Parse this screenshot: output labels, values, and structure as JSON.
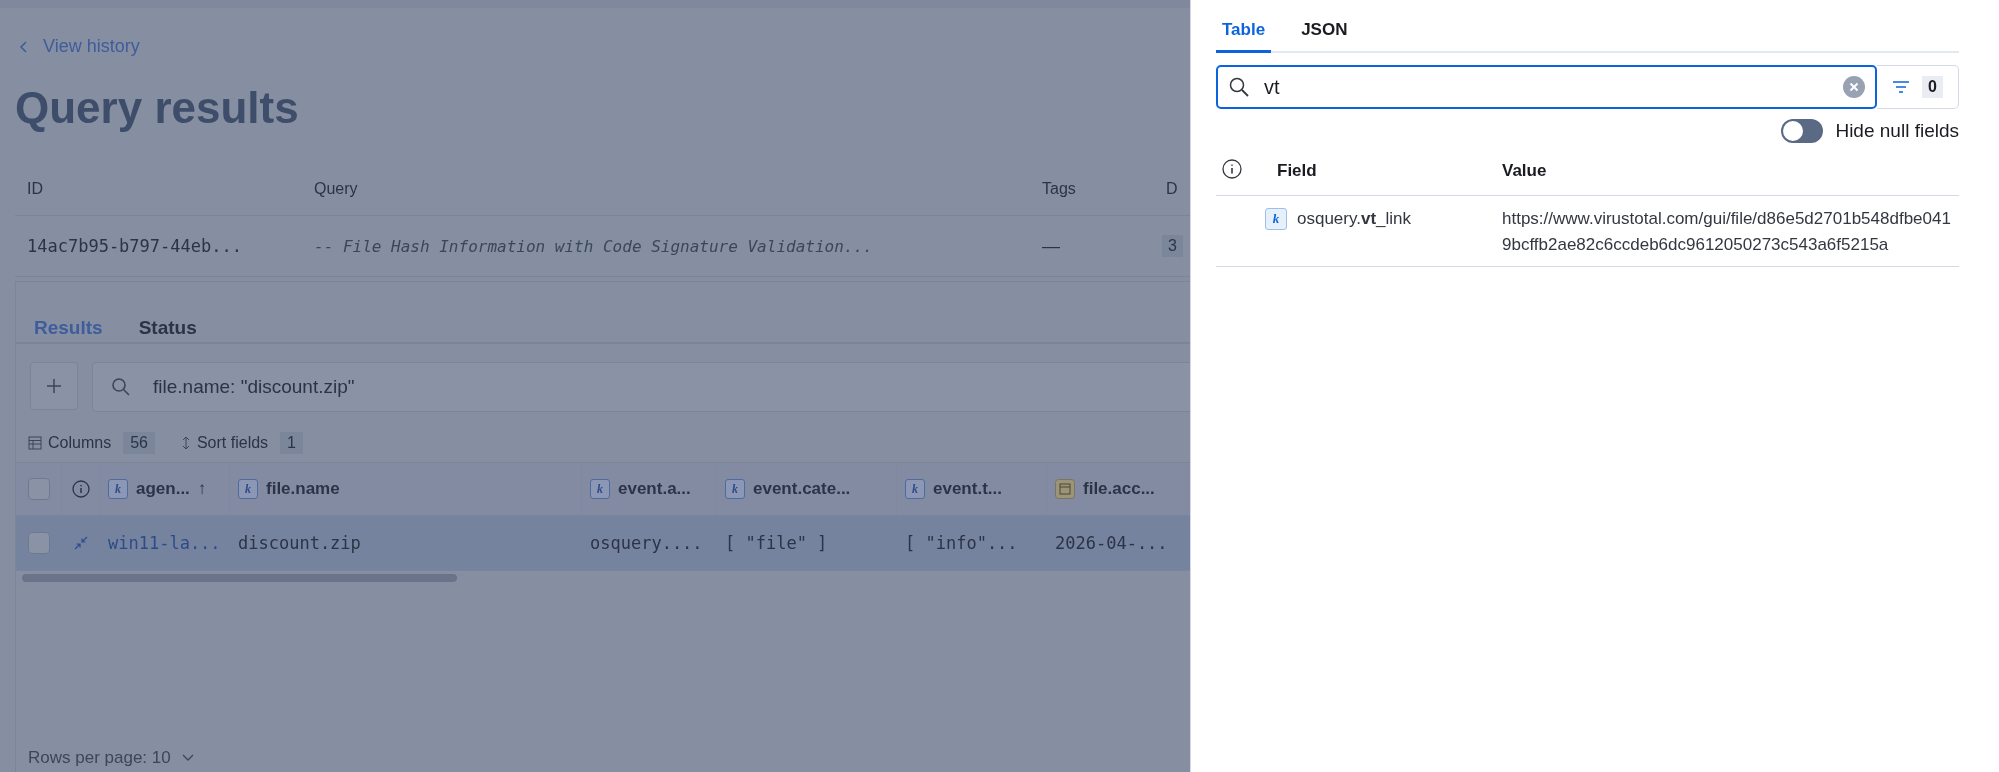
{
  "back_link": {
    "label": "View history"
  },
  "title": "Query results",
  "query_table": {
    "columns": [
      "ID",
      "Query",
      "Tags",
      "D"
    ],
    "rows": [
      [
        "14ac7b95-b797-44eb...",
        "-- File Hash Information with Code Signature Validation...",
        "—",
        "3"
      ]
    ]
  },
  "results_tabs": [
    {
      "label": "Results",
      "selected": true
    },
    {
      "label": "Status",
      "selected": false
    }
  ],
  "results_search": {
    "value": "file.name: \"discount.zip\""
  },
  "toolbar": [
    {
      "label": "Columns",
      "count": "56"
    },
    {
      "label": "Sort fields",
      "count": "1"
    }
  ],
  "grid": {
    "select_all": {
      "checked": false
    },
    "columns": [
      {
        "label": "agen...",
        "kind": "keyword",
        "type_label": "k",
        "sort": "↑"
      },
      {
        "label": "file.name",
        "kind": "keyword",
        "type_label": "k"
      },
      {
        "label": "event.a...",
        "kind": "keyword",
        "type_label": "k"
      },
      {
        "label": "event.cate...",
        "kind": "keyword",
        "type_label": "k"
      },
      {
        "label": "event.t...",
        "kind": "keyword",
        "type_label": "k"
      },
      {
        "label": "file.acc...",
        "kind": "date"
      }
    ],
    "rows": [
      {
        "selected": true,
        "checked": false,
        "cells": [
          "win11-la...",
          "discount.zip",
          "osquery....",
          "[ \"file\" ]",
          "[ \"info\"...",
          "2026-04-..."
        ]
      }
    ]
  },
  "pagination": {
    "label": "Rows per page: 10"
  },
  "flyout": {
    "tabs": [
      {
        "label": "Table",
        "selected": true
      },
      {
        "label": "JSON",
        "selected": false
      }
    ],
    "search": {
      "value": "vt"
    },
    "filter_count": "0",
    "hide_null_fields": {
      "label": "Hide null fields",
      "on": false
    },
    "columns": [
      "Field",
      "Value"
    ],
    "rows": [
      {
        "type_label": "k",
        "field": "osquery.**vt**_link",
        "value": "https://www.virustotal.com/gui/file/d86e5d2701b548dfbe0419bcffb2ae82c6ccdeb6dc9612050273c543a6f5215a"
      }
    ]
  }
}
